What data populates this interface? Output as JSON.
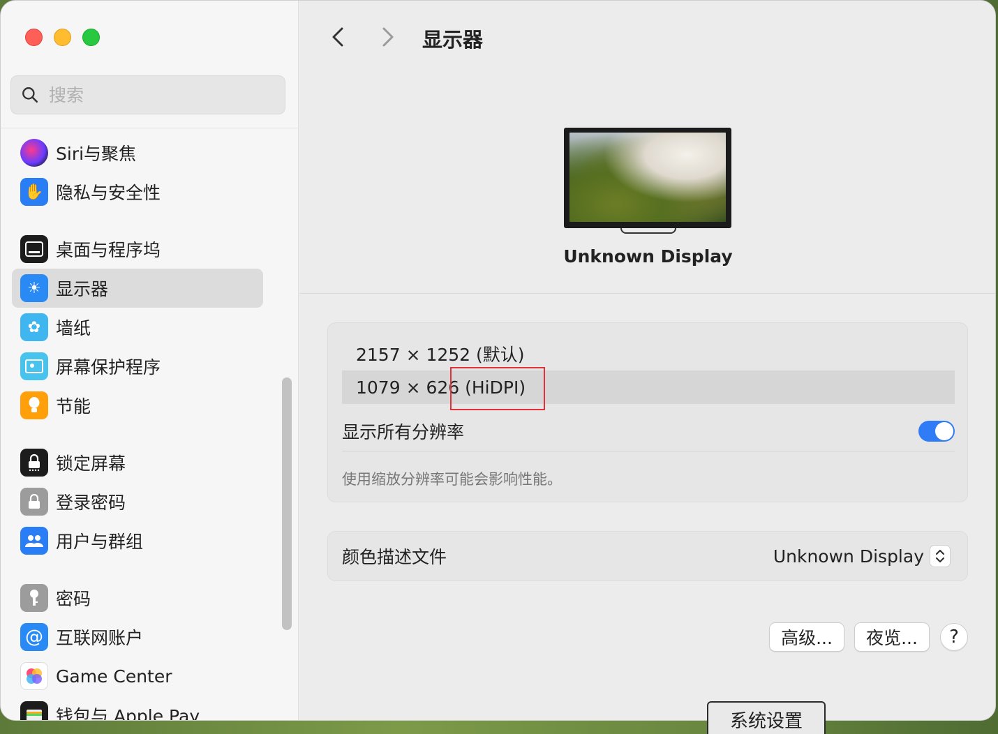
{
  "sidebar": {
    "search_placeholder": "搜索",
    "items": [
      {
        "label": "Siri与聚焦",
        "icon": "siri-icon"
      },
      {
        "label": "隐私与安全性",
        "icon": "hand-icon"
      },
      {
        "label": "桌面与程序坞",
        "icon": "dock-icon"
      },
      {
        "label": "显示器",
        "icon": "brightness-icon",
        "selected": true
      },
      {
        "label": "墙纸",
        "icon": "flower-icon"
      },
      {
        "label": "屏幕保护程序",
        "icon": "screensaver-icon"
      },
      {
        "label": "节能",
        "icon": "lightbulb-icon"
      },
      {
        "label": "锁定屏幕",
        "icon": "lock-icon"
      },
      {
        "label": "登录密码",
        "icon": "padlock-icon"
      },
      {
        "label": "用户与群组",
        "icon": "users-icon"
      },
      {
        "label": "密码",
        "icon": "key-icon"
      },
      {
        "label": "互联网账户",
        "icon": "at-icon"
      },
      {
        "label": "Game Center",
        "icon": "game-center-icon"
      },
      {
        "label": "钱包与 Apple Pay",
        "icon": "wallet-icon"
      }
    ]
  },
  "header": {
    "title": "显示器"
  },
  "display": {
    "name": "Unknown Display"
  },
  "resolution": {
    "options": [
      "2157 × 1252 (默认)",
      "1079 × 626 (HiDPI)"
    ],
    "selected_index": 1,
    "show_all_label": "显示所有分辨率",
    "show_all_on": true,
    "note": "使用缩放分辨率可能会影响性能。"
  },
  "color_profile": {
    "label": "颜色描述文件",
    "value": "Unknown Display"
  },
  "buttons": {
    "advanced": "高级...",
    "night_shift": "夜览...",
    "help": "?"
  },
  "dock_tooltip": "系统设置",
  "colors": {
    "accent": "#2f7cf6",
    "highlight_box": "#e0323a"
  }
}
